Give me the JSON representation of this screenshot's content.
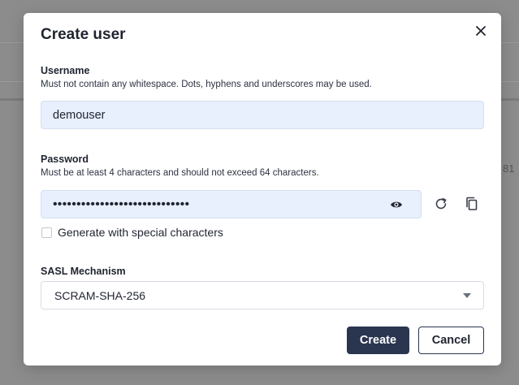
{
  "background": {
    "partial_text": "81"
  },
  "dialog": {
    "title": "Create user",
    "username": {
      "label": "Username",
      "help": "Must not contain any whitespace. Dots, hyphens and underscores may be used.",
      "value": "demouser"
    },
    "password": {
      "label": "Password",
      "help": "Must be at least 4 characters and should not exceed 64 characters.",
      "masked_value": "•••••••••••••••••••••••••••••",
      "generate_special_label": "Generate with special characters",
      "generate_special_checked": false
    },
    "sasl": {
      "label": "SASL Mechanism",
      "selected": "SCRAM-SHA-256"
    },
    "actions": {
      "create_label": "Create",
      "cancel_label": "Cancel"
    },
    "icons": {
      "close": "close-icon",
      "visibility": "eye-icon",
      "regenerate": "refresh-icon",
      "copy": "copy-icon"
    }
  },
  "colors": {
    "primary": "#2a3550",
    "input_bg": "#e8effd",
    "overlay": "#8c8c8c"
  }
}
